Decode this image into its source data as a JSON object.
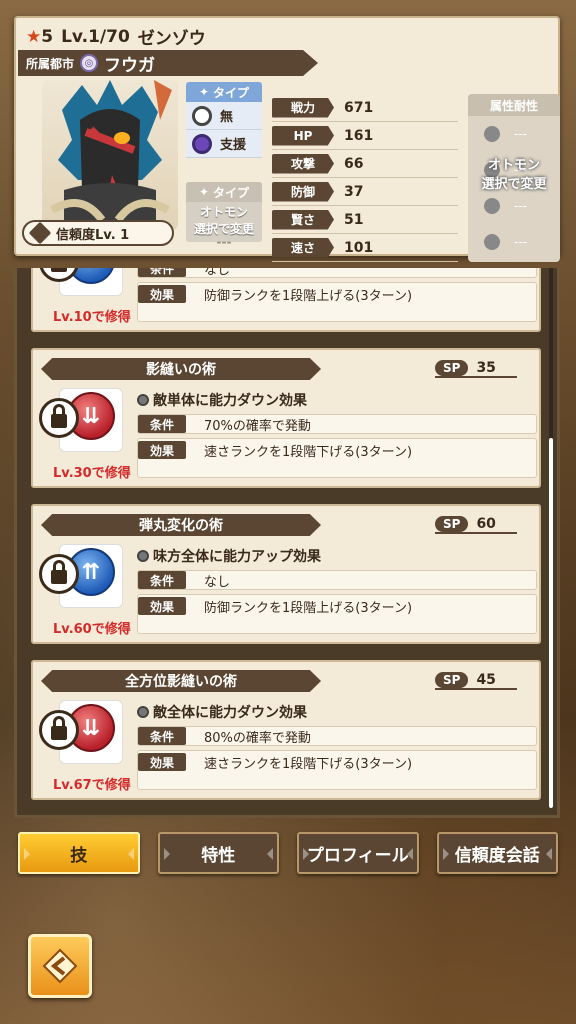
{
  "header": {
    "rarity": "5",
    "level": "Lv.1/70",
    "monster_name": "ゼンゾウ",
    "city_label": "所属都市",
    "city_name": "フウガ",
    "trust": "信頼度Lv. 1",
    "type_label": "タイプ",
    "types": [
      {
        "icon": "neutral-type-icon",
        "label": "無"
      },
      {
        "icon": "support-type-icon",
        "label": "支援"
      }
    ],
    "type2_label": "タイプ",
    "type2_note": "オトモン\n選択で変更",
    "type2_value": "---",
    "stats": [
      {
        "key": "戦力",
        "value": "671"
      },
      {
        "key": "HP",
        "value": "161"
      },
      {
        "key": "攻撃",
        "value": "66"
      },
      {
        "key": "防御",
        "value": "37"
      },
      {
        "key": "賢さ",
        "value": "51"
      },
      {
        "key": "速さ",
        "value": "101"
      }
    ],
    "resist_label": "属性耐性",
    "resist_note": "オトモン\n選択で変更",
    "resist_values": [
      "---",
      "---",
      "---",
      "---"
    ]
  },
  "skills": [
    {
      "name": "",
      "sp": "",
      "orb": "blue",
      "desc": "",
      "cond_key": "条件",
      "cond": "なし",
      "eff_key": "効果",
      "eff": "防御ランクを1段階上げる(3ターン)",
      "unlock": "Lv.10で修得"
    },
    {
      "name": "影縫いの術",
      "sp": "35",
      "orb": "red",
      "desc": "敵単体に能力ダウン効果",
      "cond_key": "条件",
      "cond": "70%の確率で発動",
      "eff_key": "効果",
      "eff": "速さランクを1段階下げる(3ターン)",
      "unlock": "Lv.30で修得"
    },
    {
      "name": "弾丸変化の術",
      "sp": "60",
      "orb": "blue",
      "desc": "味方全体に能力アップ効果",
      "cond_key": "条件",
      "cond": "なし",
      "eff_key": "効果",
      "eff": "防御ランクを1段階上げる(3ターン)",
      "unlock": "Lv.60で修得"
    },
    {
      "name": "全方位影縫いの術",
      "sp": "45",
      "orb": "red",
      "desc": "敵全体に能力ダウン効果",
      "cond_key": "条件",
      "cond": "80%の確率で発動",
      "eff_key": "効果",
      "eff": "速さランクを1段階下げる(3ターン)",
      "unlock": "Lv.67で修得"
    }
  ],
  "sp_label": "SP",
  "tabs": [
    "技",
    "特性",
    "プロフィール",
    "信頼度会話"
  ],
  "active_tab": "技"
}
